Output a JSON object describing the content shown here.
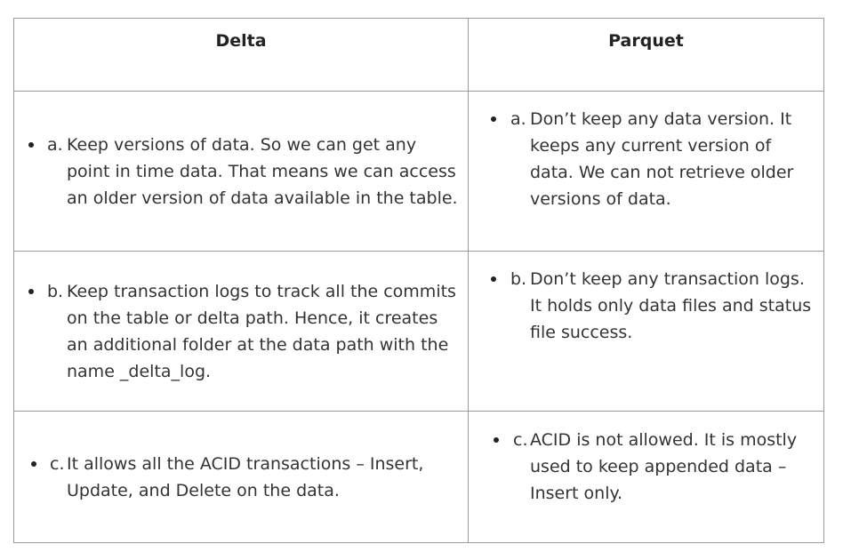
{
  "table": {
    "headers": [
      "Delta",
      "Parquet"
    ],
    "rows": [
      {
        "delta": {
          "prefix": "a.",
          "text": "Keep versions of data. So we can get any point in time data. That means we can access an older version of data available in the table."
        },
        "parquet": {
          "prefix": "a.",
          "text": "Don’t keep any data version. It keeps any current version of data. We can not retrieve older versions of data."
        }
      },
      {
        "delta": {
          "prefix": "b.",
          "text": "Keep transaction logs to track all the commits on the table or delta path. Hence, it creates an additional folder at the data path with the name _delta_log."
        },
        "parquet": {
          "prefix": "b.",
          "text": "Don’t keep any transaction logs. It holds only data files and status file success."
        }
      },
      {
        "delta": {
          "prefix": "c.",
          "text": "It allows all the ACID transactions – Insert, Update, and Delete on the data."
        },
        "parquet": {
          "prefix": "c.",
          "text": "ACID is not allowed. It is mostly used to keep appended data – Insert only."
        }
      }
    ]
  }
}
